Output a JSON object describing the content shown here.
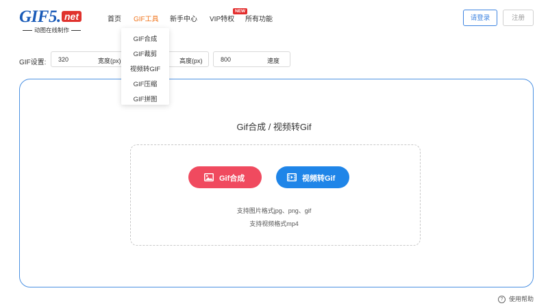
{
  "logo": {
    "main": "GIF5.",
    "badge": "net",
    "subtitle": "动图在线制作"
  },
  "nav": {
    "items": [
      "首页",
      "GIF工具",
      "新手中心",
      "VIP特权",
      "所有功能"
    ],
    "new_badge": "NEW"
  },
  "auth": {
    "login": "请登录",
    "register": "注册"
  },
  "dropdown": {
    "items": [
      "GIF合成",
      "GIF裁剪",
      "视频转GIF",
      "GIF压缩",
      "GIF拼图"
    ]
  },
  "settings": {
    "label": "GIF设置:",
    "width": {
      "value": "320",
      "unit": "宽度(px)"
    },
    "height": {
      "value": "",
      "unit": "高度(px)"
    },
    "speed": {
      "value": "800",
      "unit": "速度"
    }
  },
  "main": {
    "title": "Gif合成 / 视频转Gif",
    "btn_gif": "Gif合成",
    "btn_video": "视频转Gif",
    "hint_image": "支持图片格式jpg、png、gif",
    "hint_video": "支持视频格式mp4"
  },
  "help": {
    "label": "使用帮助",
    "icon": "?"
  },
  "colors": {
    "accent": "#f0741b",
    "brand": "#1a5bb8",
    "gif_button": "#f04a5f",
    "video_button": "#1f85e8",
    "card_border": "#4a90e2"
  }
}
